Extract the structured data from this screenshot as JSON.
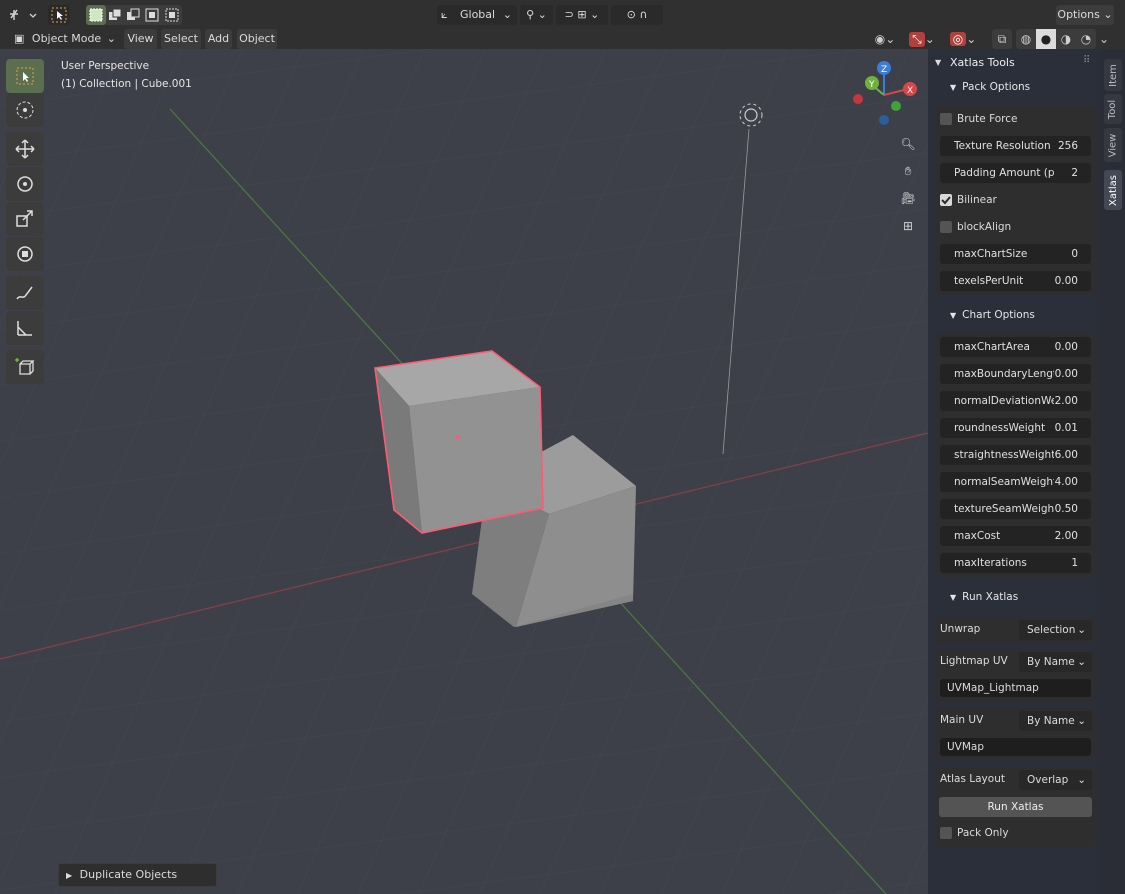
{
  "header": {
    "transform_orientation": "Global",
    "options_label": "Options",
    "mode": "Object Mode",
    "menus": [
      "View",
      "Select",
      "Add",
      "Object"
    ]
  },
  "viewport": {
    "perspective_label": "User Perspective",
    "collection_label": "(1) Collection | Cube.001",
    "gizmo_axes": [
      "Z",
      "Y",
      "X"
    ],
    "operator_panel": "Duplicate Objects"
  },
  "tabs": [
    "Item",
    "Tool",
    "View",
    "Xatlas"
  ],
  "panel": {
    "title": "Xatlas Tools",
    "pack_section": "Pack Options",
    "pack_options": {
      "brute_force": "Brute Force",
      "brute_force_checked": false,
      "texture_resolution_label": "Texture Resolution (p",
      "texture_resolution_value": "256",
      "padding_label": "Padding Amount (px)",
      "padding_value": "2",
      "bilinear": "Bilinear",
      "bilinear_checked": true,
      "block_align": "blockAlign",
      "block_align_checked": false,
      "max_chart_size_label": "maxChartSize",
      "max_chart_size_value": "0",
      "texels_label": "texelsPerUnit",
      "texels_value": "0.00"
    },
    "chart_section": "Chart Options",
    "chart_options": [
      {
        "label": "maxChartArea",
        "value": "0.00"
      },
      {
        "label": "maxBoundaryLengt",
        "value": "0.00"
      },
      {
        "label": "normalDeviationWei",
        "value": "2.00"
      },
      {
        "label": "roundnessWeight",
        "value": "0.01"
      },
      {
        "label": "straightnessWeight",
        "value": "6.00"
      },
      {
        "label": "normalSeamWeight",
        "value": "4.00"
      },
      {
        "label": "textureSeamWeight",
        "value": "0.50"
      },
      {
        "label": "maxCost",
        "value": "2.00"
      },
      {
        "label": "maxIterations",
        "value": "1"
      }
    ],
    "run_section": "Run Xatlas",
    "unwrap_label": "Unwrap",
    "unwrap_value": "Selection",
    "lightmap_label": "Lightmap UV",
    "lightmap_mode": "By Name",
    "lightmap_name": "UVMap_Lightmap",
    "main_uv_label": "Main UV",
    "main_uv_mode": "By Name",
    "main_uv_name": "UVMap",
    "atlas_layout_label": "Atlas Layout",
    "atlas_layout_value": "Overlap",
    "run_button": "Run Xatlas",
    "pack_only": "Pack Only",
    "pack_only_checked": false
  },
  "colors": {
    "viewport_bg": "#3d4049",
    "selection_outline": "#ff5a73",
    "active_tool": "#5b6e4f",
    "x_axis": "#d9464a",
    "y_axis": "#6fb33e",
    "z_axis": "#3b7ed6"
  }
}
